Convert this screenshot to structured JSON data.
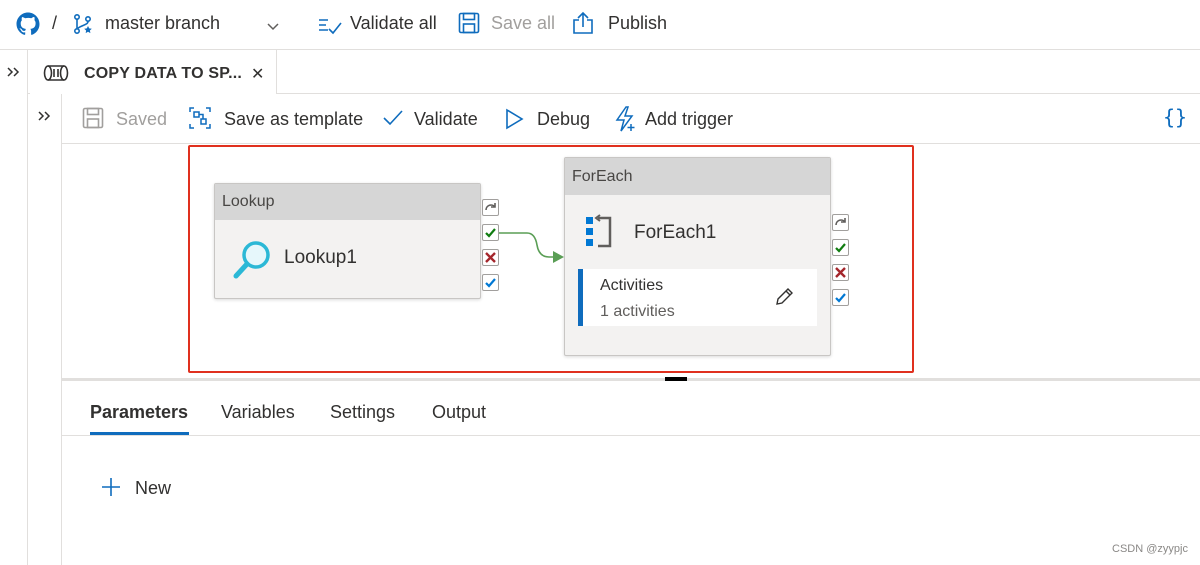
{
  "topbar": {
    "separator": "/",
    "branch": "master branch",
    "validate_all": "Validate all",
    "save_all": "Save all",
    "publish": "Publish"
  },
  "tab": {
    "title": "COPY DATA TO SP...",
    "close": "✕"
  },
  "toolbar": {
    "saved": "Saved",
    "save_as_template": "Save as template",
    "validate": "Validate",
    "debug": "Debug",
    "add_trigger": "Add trigger",
    "code_icon": "{}"
  },
  "canvas": {
    "lookup_node": {
      "type_label": "Lookup",
      "name": "Lookup1"
    },
    "foreach_node": {
      "type_label": "ForEach",
      "name": "ForEach1",
      "activities_label": "Activities",
      "activities_count": "1 activities"
    },
    "colors": {
      "success": "#107c10",
      "failure": "#a4262c",
      "completion": "#0078d4",
      "connector": "#5a9e55",
      "highlight": "#e0301e"
    }
  },
  "panel": {
    "tabs": [
      "Parameters",
      "Variables",
      "Settings",
      "Output"
    ],
    "active_tab": "Parameters",
    "new_label": "New"
  },
  "watermark": "CSDN @zyypjc"
}
